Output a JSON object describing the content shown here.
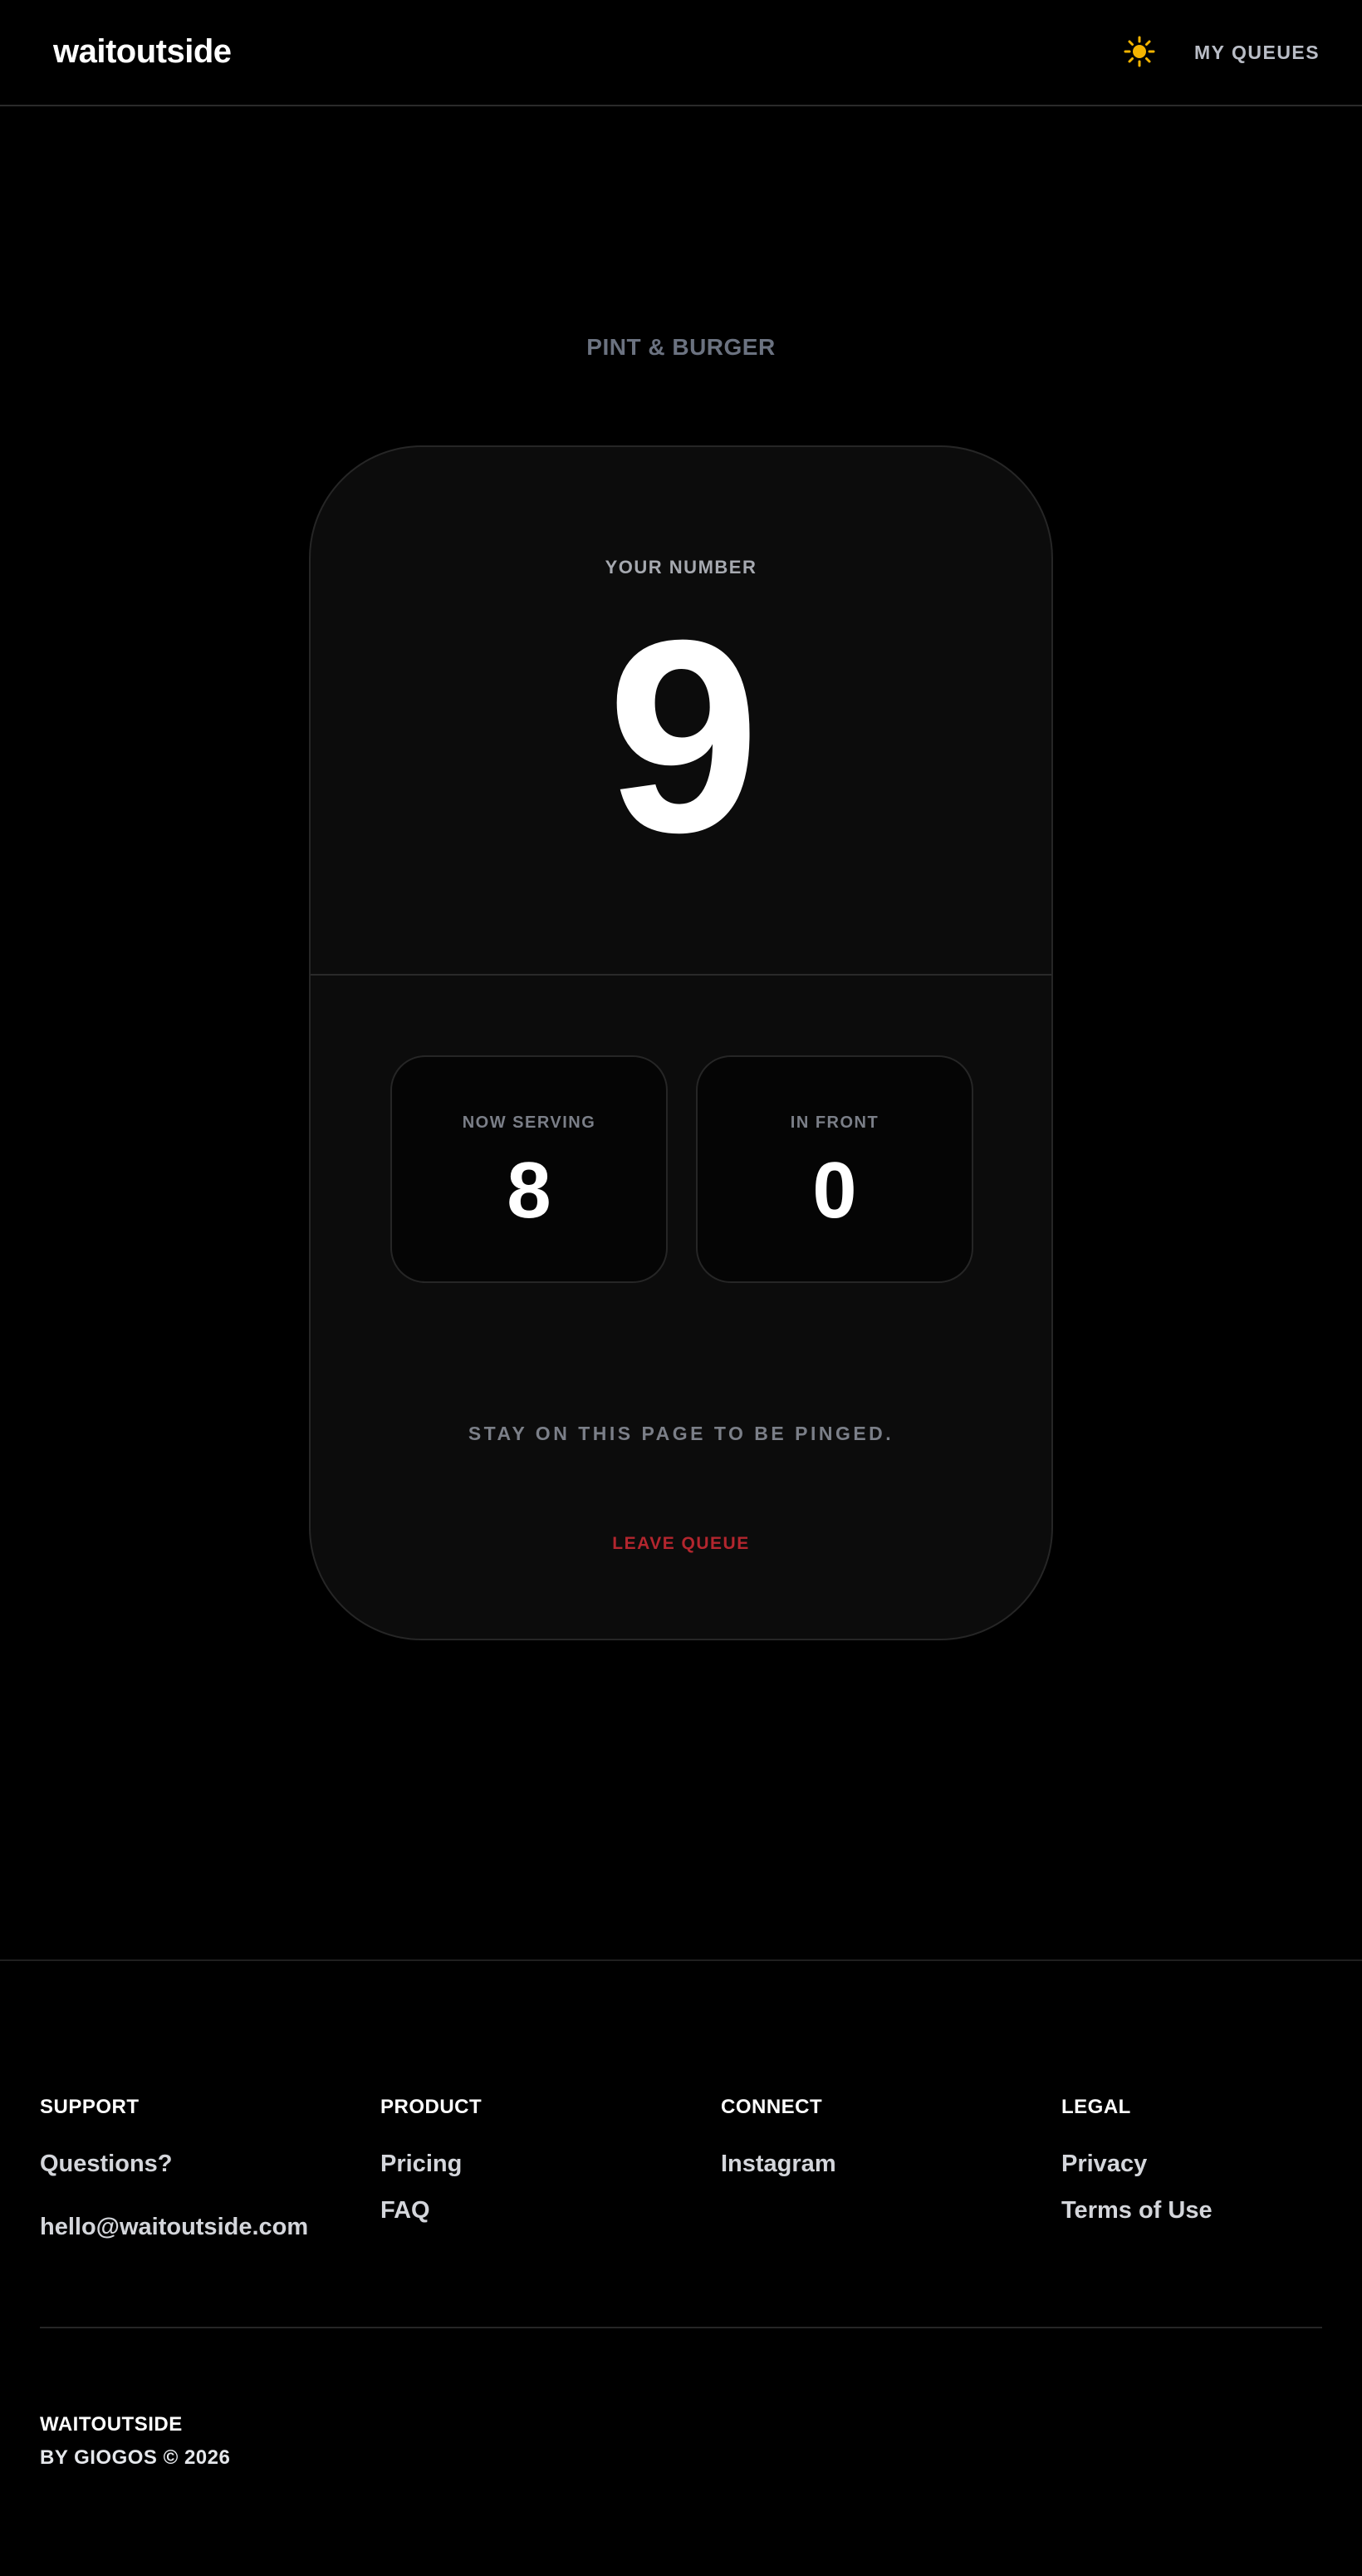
{
  "header": {
    "logo": "waitoutside",
    "theme_icon": "sun-icon",
    "nav_my_queues": "MY QUEUES"
  },
  "venue": {
    "name": "PINT & BURGER"
  },
  "ticket": {
    "your_number_label": "YOUR NUMBER",
    "your_number": "9",
    "stats": {
      "now_serving_label": "NOW SERVING",
      "now_serving_value": "8",
      "in_front_label": "IN FRONT",
      "in_front_value": "0"
    },
    "ping_note": "STAY ON THIS PAGE TO BE PINGED.",
    "leave_label": "LEAVE QUEUE"
  },
  "footer": {
    "support": {
      "heading": "SUPPORT",
      "question": "Questions?",
      "email": "hello@waitoutside.com"
    },
    "product": {
      "heading": "PRODUCT",
      "links": [
        "Pricing",
        "FAQ"
      ]
    },
    "connect": {
      "heading": "CONNECT",
      "links": [
        "Instagram"
      ]
    },
    "legal": {
      "heading": "LEGAL",
      "links": [
        "Privacy",
        "Terms of Use"
      ]
    },
    "brand": "WAITOUTSIDE",
    "byline": "BY GIOGOS © 2026"
  },
  "colors": {
    "background": "#000000",
    "card": "#0c0c0c",
    "muted_text": "#6b7280",
    "danger": "#b3262e",
    "sun": "#f5b400"
  }
}
